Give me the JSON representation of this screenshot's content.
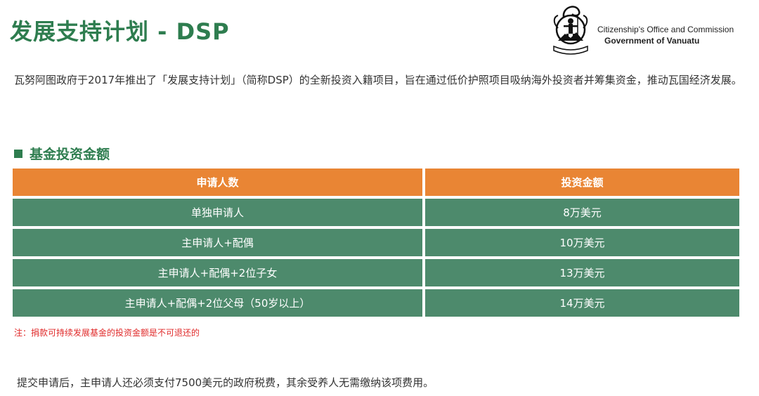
{
  "header": {
    "title": "发展支持计划 - DSP",
    "office_line1": "Citizenship's Office and Commission",
    "office_line2": "Government of Vanuatu",
    "emblem_icon": "vanuatu-coat-of-arms-icon",
    "emblem_motto": "LONG GOD YUMI STANAP"
  },
  "intro": {
    "text": "瓦努阿图政府于2017年推出了「发展支持计划」（简称DSP）的全新投资入籍项目，旨在通过低价护照项目吸纳海外投资者并筹集资金，推动瓦国经济发展。"
  },
  "section": {
    "title": "基金投资金额"
  },
  "table": {
    "headers": [
      "申请人数",
      "投资金额"
    ],
    "rows": [
      [
        "单独申请人",
        "8万美元"
      ],
      [
        "主申请人+配偶",
        "10万美元"
      ],
      [
        "主申请人+配偶+2位子女",
        "13万美元"
      ],
      [
        "主申请人+配偶+2位父母（50岁以上）",
        "14万美元"
      ]
    ]
  },
  "note": {
    "text": "注：捐款可持续发展基金的投资金额是不可退还的"
  },
  "footer": {
    "text": "提交申请后，主申请人还必须支付7500美元的政府税费，其余受养人无需缴纳该项费用。"
  },
  "colors": {
    "brand_green": "#2e7d4f",
    "header_orange": "#e98534",
    "row_green": "#4d8a6c",
    "note_red": "#e02a2a"
  }
}
